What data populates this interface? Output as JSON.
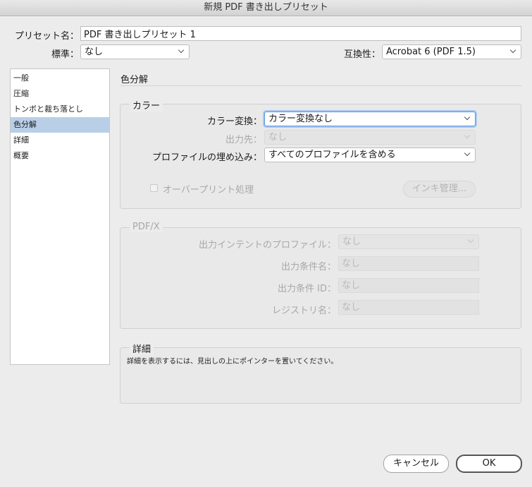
{
  "window": {
    "title": "新規 PDF 書き出しプリセット"
  },
  "header": {
    "preset_label": "プリセット名：",
    "preset_value": "PDF 書き出しプリセット 1",
    "standard_label": "標準：",
    "standard_value": "なし",
    "compat_label": "互換性：",
    "compat_value": "Acrobat 6 (PDF 1.5)"
  },
  "sidebar": {
    "items": [
      {
        "label": "一般"
      },
      {
        "label": "圧縮"
      },
      {
        "label": "トンボと裁ち落とし"
      },
      {
        "label": "色分解"
      },
      {
        "label": "詳細"
      },
      {
        "label": "概要"
      }
    ],
    "selected_index": 3
  },
  "panel": {
    "title": "色分解"
  },
  "color_group": {
    "title": "カラー",
    "conversion_label": "カラー変換：",
    "conversion_value": "カラー変換なし",
    "destination_label": "出力先：",
    "destination_value": "なし",
    "profile_label": "プロファイルの埋め込み：",
    "profile_value": "すべてのプロファイルを含める",
    "overprint_label": "オーバープリント処理",
    "overprint_checked": false,
    "ink_button": "インキ管理..."
  },
  "pdfx_group": {
    "title": "PDF/X",
    "intent_label": "出力インテントのプロファイル：",
    "intent_value": "なし",
    "condition_name_label": "出力条件名：",
    "condition_name_value": "なし",
    "condition_id_label": "出力条件 ID：",
    "condition_id_value": "なし",
    "registry_label": "レジストリ名：",
    "registry_value": "なし"
  },
  "details_group": {
    "title": "詳細",
    "text": "詳細を表示するには、見出しの上にポインターを置いてください。"
  },
  "footer": {
    "cancel_label": "キャンセル",
    "ok_label": "OK"
  }
}
